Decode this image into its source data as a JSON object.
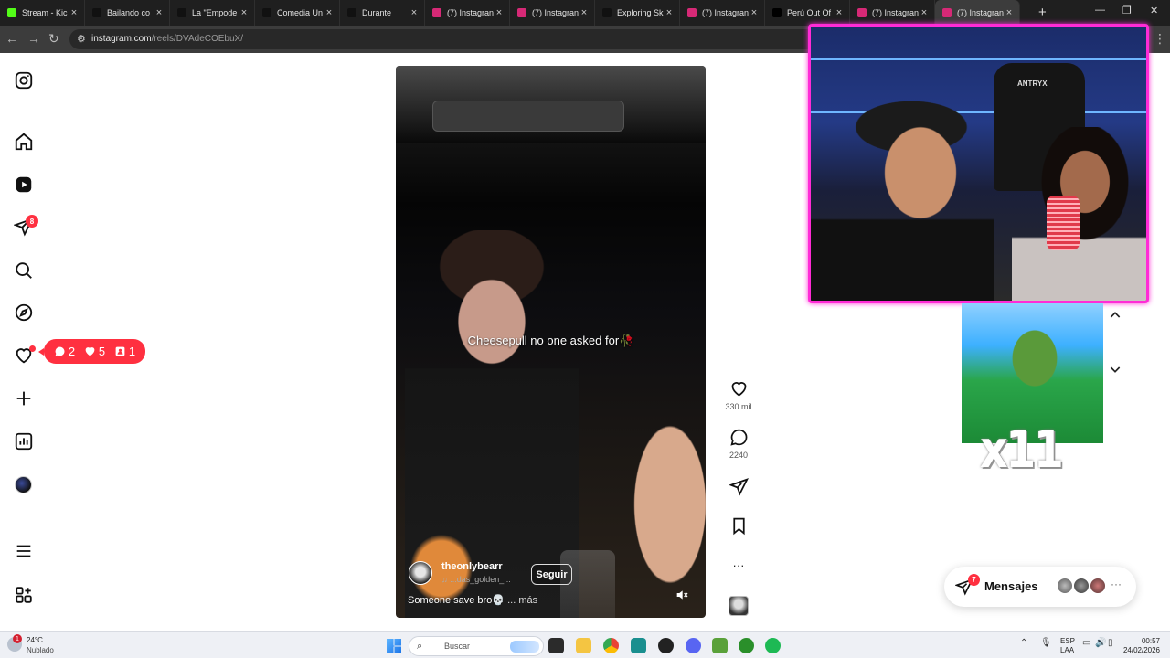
{
  "browser": {
    "tabs": [
      {
        "title": "Stream - Kic",
        "favicon_color": "#53fc18",
        "active": false
      },
      {
        "title": "Bailando co",
        "favicon_color": "#111111",
        "active": false
      },
      {
        "title": "La \"Empode",
        "favicon_color": "#111111",
        "active": false
      },
      {
        "title": "Comedia Un",
        "favicon_color": "#111111",
        "active": false
      },
      {
        "title": "Durante",
        "favicon_color": "#111111",
        "active": false
      },
      {
        "title": "(7) Instagran",
        "favicon_color": "#d62976",
        "active": false
      },
      {
        "title": "(7) Instagran",
        "favicon_color": "#d62976",
        "active": false
      },
      {
        "title": "Exploring Sk",
        "favicon_color": "#111111",
        "active": false
      },
      {
        "title": "(7) Instagran",
        "favicon_color": "#d62976",
        "active": false
      },
      {
        "title": "Perú Out Of",
        "favicon_color": "#000000",
        "active": false
      },
      {
        "title": "(7) Instagran",
        "favicon_color": "#d62976",
        "active": false
      },
      {
        "title": "(7) Instagran",
        "favicon_color": "#d62976",
        "active": true
      }
    ],
    "tab_close_glyph": "×",
    "new_tab_glyph": "+",
    "url_host": "instagram.com",
    "url_path": "/reels/DVAdeCOEbuX/"
  },
  "sidebar": {
    "dm_badge": "8",
    "notification_pill": {
      "comments": "2",
      "likes": "5",
      "follows": "1"
    }
  },
  "reel": {
    "caption_overlay": "Cheesepull no one asked for🥀",
    "author": "theonlybearr",
    "author_sub": "♫ ...das_golden_...",
    "follow_label": "Seguir",
    "description": "Someone save bro💀",
    "more_label": "... más",
    "likes": "330 mil",
    "comments": "2240",
    "more_glyph": "···"
  },
  "overlay": {
    "webcam_brand": "ANTRYX",
    "gif_text": "x11"
  },
  "messages": {
    "label": "Mensajes",
    "badge": "7",
    "more_glyph": "···"
  },
  "taskbar": {
    "weather_badge": "1",
    "temperature": "24°C",
    "weather": "Nublado",
    "search_label": "Buscar",
    "lang1": "ESP",
    "lang2": "LAA",
    "time": "00:57",
    "date": "24/02/2026"
  },
  "colors": {
    "accent_red": "#ff3040",
    "webcam_border": "#ff2bd6"
  }
}
